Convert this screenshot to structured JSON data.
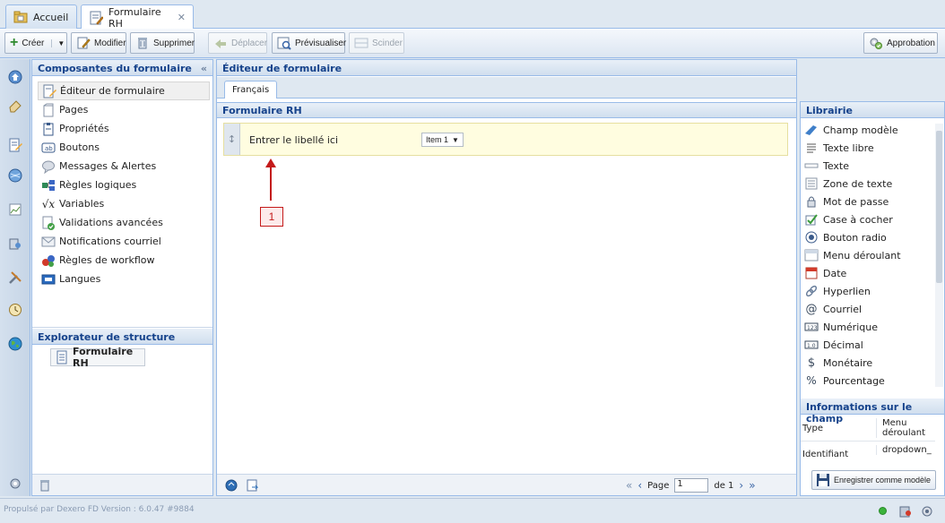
{
  "tabs": [
    {
      "label": "Accueil",
      "icon": "home-folder-icon"
    },
    {
      "label": "Formulaire RH",
      "icon": "form-edit-icon",
      "close": "✕"
    }
  ],
  "toolbar": {
    "create": "Créer",
    "modify": "Modifier",
    "delete": "Supprimer",
    "move": "Déplacer",
    "preview": "Prévisualiser",
    "split": "Scinder",
    "approval": "Approbation"
  },
  "left_panel": {
    "title": "Composantes du formulaire",
    "collapse": "«",
    "items": [
      {
        "label": "Éditeur de formulaire",
        "icon": "form-editor-icon"
      },
      {
        "label": "Pages",
        "icon": "pages-icon"
      },
      {
        "label": "Propriétés",
        "icon": "properties-icon"
      },
      {
        "label": "Boutons",
        "icon": "buttons-icon"
      },
      {
        "label": "Messages & Alertes",
        "icon": "messages-icon"
      },
      {
        "label": "Règles logiques",
        "icon": "logic-rules-icon"
      },
      {
        "label": "Variables",
        "icon": "variables-icon"
      },
      {
        "label": "Validations avancées",
        "icon": "validations-icon"
      },
      {
        "label": "Notifications courriel",
        "icon": "email-notifications-icon"
      },
      {
        "label": "Règles de workflow",
        "icon": "workflow-icon"
      },
      {
        "label": "Langues",
        "icon": "languages-icon"
      }
    ],
    "explorer_title": "Explorateur de structure",
    "explorer_item": "Formulaire RH"
  },
  "editor": {
    "title": "Éditeur de formulaire",
    "lang_tab": "Français",
    "form_title": "Formulaire RH",
    "field_label": "Entrer le libellé ici",
    "dropdown_value": "Item 1",
    "callout": "1",
    "pagination": {
      "page_label": "Page",
      "page_value": "1",
      "of_label": "de 1"
    }
  },
  "library": {
    "title": "Librairie",
    "items": [
      {
        "label": "Champ modèle",
        "icon": "template-field-icon"
      },
      {
        "label": "Texte libre",
        "icon": "free-text-icon"
      },
      {
        "label": "Texte",
        "icon": "text-icon"
      },
      {
        "label": "Zone de texte",
        "icon": "textarea-icon"
      },
      {
        "label": "Mot de passe",
        "icon": "password-icon"
      },
      {
        "label": "Case à cocher",
        "icon": "checkbox-icon"
      },
      {
        "label": "Bouton radio",
        "icon": "radio-button-icon"
      },
      {
        "label": "Menu déroulant",
        "icon": "dropdown-icon"
      },
      {
        "label": "Date",
        "icon": "date-icon"
      },
      {
        "label": "Hyperlien",
        "icon": "hyperlink-icon"
      },
      {
        "label": "Courriel",
        "icon": "email-icon"
      },
      {
        "label": "Numérique",
        "icon": "numeric-icon"
      },
      {
        "label": "Décimal",
        "icon": "decimal-icon"
      },
      {
        "label": "Monétaire",
        "icon": "currency-icon"
      },
      {
        "label": "Pourcentage",
        "icon": "percentage-icon"
      }
    ]
  },
  "field_info": {
    "title": "Informations sur le champ",
    "rows": [
      {
        "key": "Type",
        "value": "Menu déroulant"
      },
      {
        "key": "Identifiant",
        "value": "dropdown_t"
      }
    ],
    "save_template": "Enregistrer comme modèle"
  },
  "footer": {
    "powered": "Propulsé par Dexero FD Version : 6.0.47 #9884"
  },
  "colors": {
    "accent": "#15428b",
    "border": "#99bbe8",
    "field_bg": "#fffde0",
    "callout": "#c41a1a"
  }
}
